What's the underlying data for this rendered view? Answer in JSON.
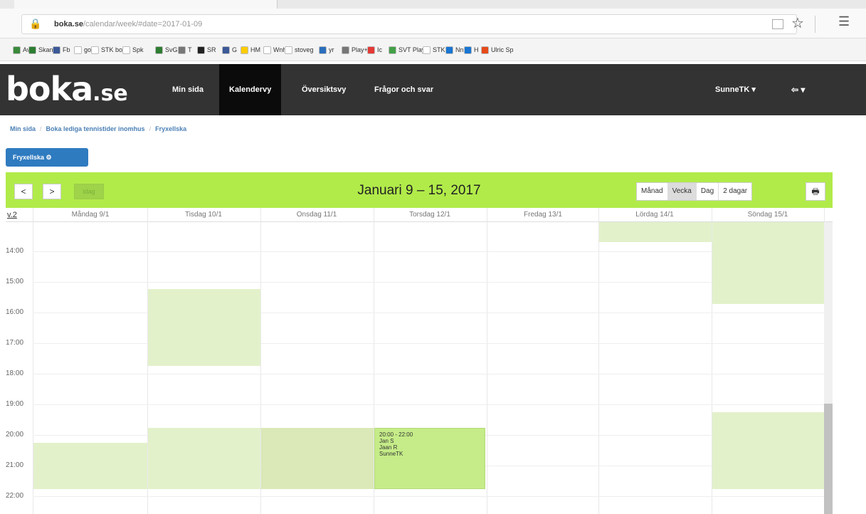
{
  "browser": {
    "url_host": "boka.se",
    "url_rest": "/calendar/week/#date=2017-01-09",
    "bookmarks": [
      {
        "label": "Av",
        "color": "#3a8a3a"
      },
      {
        "label": "Skand",
        "color": "#2e7d32"
      },
      {
        "label": "Fb",
        "color": "#3b5998"
      },
      {
        "label": "go",
        "color": "#ffffff"
      },
      {
        "label": "STK boka",
        "color": "#ffffff"
      },
      {
        "label": "Spk",
        "color": "#ffffff"
      },
      {
        "label": "SvG",
        "color": "#2e7d32"
      },
      {
        "label": "T",
        "color": "#777777"
      },
      {
        "label": "SR",
        "color": "#222222"
      },
      {
        "label": "G",
        "color": "#3b5998"
      },
      {
        "label": "HM",
        "color": "#ffcc00"
      },
      {
        "label": "Wnh",
        "color": "#ffffff"
      },
      {
        "label": "stoveg",
        "color": "#ffffff"
      },
      {
        "label": "yr",
        "color": "#2a6ebb"
      },
      {
        "label": "Play+",
        "color": "#777777"
      },
      {
        "label": "Ic",
        "color": "#e53935"
      },
      {
        "label": "SVT Play",
        "color": "#43a047"
      },
      {
        "label": "STK",
        "color": "#ffffff"
      },
      {
        "label": "Nn",
        "color": "#1976d2"
      },
      {
        "label": "H",
        "color": "#1976d2"
      },
      {
        "label": "Ulric Sp",
        "color": "#e64a19"
      }
    ]
  },
  "site": {
    "logo_main": "boka",
    "logo_tld": ".se",
    "nav": [
      "Min sida",
      "Kalendervy",
      "Översiktsvy",
      "Frågor och svar"
    ],
    "user": "SunneTK ▾",
    "back": "⇦ ▾"
  },
  "breadcrumb": [
    "Min sida",
    "Boka lediga tennistider inomhus",
    "Fryxellska"
  ],
  "resource_button": "Fryxellska ⚙",
  "calendar": {
    "title": "Januari 9 – 15, 2017",
    "prev": "<",
    "next": ">",
    "today": "idag",
    "views": [
      "Månad",
      "Vecka",
      "Dag",
      "2 dagar"
    ],
    "active_view": "Vecka",
    "print_icon": "printer-icon",
    "week_label": "v.2",
    "days": [
      "Måndag 9/1",
      "Tisdag 10/1",
      "Onsdag 11/1",
      "Torsdag 12/1",
      "Fredag 13/1",
      "Lördag 14/1",
      "Söndag 15/1"
    ],
    "times": [
      "14:00",
      "15:00",
      "16:00",
      "17:00",
      "18:00",
      "19:00",
      "20:00",
      "21:00",
      "22:00"
    ],
    "event": {
      "time": "20:00 - 22:00",
      "players": [
        "Jan S",
        "Jaan R",
        "SunneTK"
      ]
    }
  },
  "colors": {
    "accent": "#b1eb4a",
    "nav_bg": "#333333",
    "button_blue": "#2f7bc0"
  }
}
